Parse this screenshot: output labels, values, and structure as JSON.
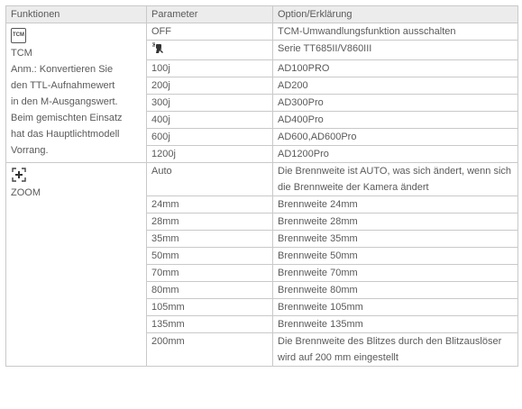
{
  "header": {
    "col1": "Funktionen",
    "col2": "Parameter",
    "col3": "Option/Erklärung"
  },
  "tcm": {
    "icon_text": "TCM",
    "name": "TCM",
    "note_lines": [
      "Anm.: Konvertieren Sie",
      "den TTL-Aufnahmewert",
      "in den M-Ausgangswert.",
      "Beim gemischten Einsatz",
      "hat das Hauptlichtmodell",
      "Vorrang."
    ],
    "rows": [
      {
        "param": "OFF",
        "option": "TCM-Umwandlungsfunktion ausschalten"
      },
      {
        "param": "",
        "param_icon": "flash-trigger-icon",
        "option": "Serie TT685II/V860III"
      },
      {
        "param": "100j",
        "option": "AD100PRO"
      },
      {
        "param": "200j",
        "option": "AD200"
      },
      {
        "param": "300j",
        "option": "AD300Pro"
      },
      {
        "param": "400j",
        "option": "AD400Pro"
      },
      {
        "param": "600j",
        "option": "AD600,AD600Pro"
      },
      {
        "param": "1200j",
        "option": "AD1200Pro"
      }
    ]
  },
  "zoom": {
    "icon": "zoom-icon",
    "name": "ZOOM",
    "rows": [
      {
        "param": "Auto",
        "option": "Die Brennweite ist AUTO, was sich ändert, wenn sich die Brennweite der Kamera ändert"
      },
      {
        "param": "24mm",
        "option": "Brennweite 24mm"
      },
      {
        "param": "28mm",
        "option": "Brennweite 28mm"
      },
      {
        "param": "35mm",
        "option": "Brennweite 35mm"
      },
      {
        "param": "50mm",
        "option": "Brennweite 50mm"
      },
      {
        "param": "70mm",
        "option": "Brennweite 70mm"
      },
      {
        "param": "80mm",
        "option": "Brennweite 80mm"
      },
      {
        "param": "105mm",
        "option": "Brennweite 105mm"
      },
      {
        "param": "135mm",
        "option": "Brennweite 135mm"
      },
      {
        "param": "200mm",
        "option": "Die Brennweite des Blitzes durch den Blitzauslöser wird auf 200 mm eingestellt"
      }
    ]
  }
}
